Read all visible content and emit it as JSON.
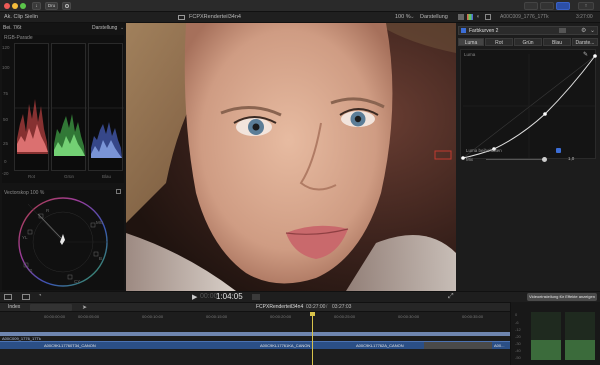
{
  "app": {
    "window_buttons": [
      "close",
      "minimize",
      "zoom"
    ],
    "toolbar_badge": "Dru"
  },
  "header": {
    "left_label": "Ak. Clip Sielin",
    "file_name": "FCPXRenderteil34n4",
    "zoom": "100 %",
    "view_label": "Darstellung",
    "timecode_right": "A00C009_1776_17Tk",
    "duration_right": "3:27:00"
  },
  "scopes": {
    "header_left": "Bei. 7/6t",
    "header_right": "Darstellung",
    "rgb_title": "RGB-Parade",
    "scale": [
      "120",
      "100",
      "75",
      "50",
      "25",
      "0",
      "-20"
    ],
    "channels": [
      "Rot",
      "Grün",
      "Blau"
    ],
    "vector_title": "Vectorskop 100 %",
    "vector_labels": [
      "R",
      "MG",
      "B",
      "YL",
      "G",
      "CY"
    ]
  },
  "inspector": {
    "effect_title": "Farbkurven 2",
    "tabs": [
      "Luma",
      "Rot",
      "Grün",
      "Blau",
      "Darste..."
    ],
    "curve_label": "Luma",
    "preserve_label": "Luma beibehalten",
    "mix_label": "Mix",
    "mix_value": "1,0"
  },
  "viewer_bar": {
    "timecode": "1:04:05",
    "timecode_dim": "00:00"
  },
  "timeline": {
    "index_label": "Index",
    "project_name": "FCPXRenderteil34n4",
    "position": "03:27:00",
    "duration": "03:27:03",
    "effects_tooltip": "Videoeinstellung für Effekte anzeigen",
    "ruler": [
      "00:00:00:00",
      "00:00:05:00",
      "00:00:10:00",
      "00:00:15:00",
      "00:00:20:00",
      "00:00:25:00",
      "00:00:30:00",
      "00:00:35:00"
    ],
    "clip_title": "A00C009_1776_17Tk",
    "clips": [
      "A00C9KL17760T34_CANON",
      "A00C9KL17761KA_CANON",
      "A00C9KL17762A_CANON",
      "A00..."
    ],
    "meter_scale": [
      "0",
      "-6",
      "-12",
      "-20",
      "-30",
      "-40",
      "-50"
    ]
  },
  "colors": {
    "accent_blue": "#3c6ed7",
    "clip_blue": "#2b4f86",
    "playhead": "#d8c24a",
    "bg": "#1b1b1b"
  }
}
